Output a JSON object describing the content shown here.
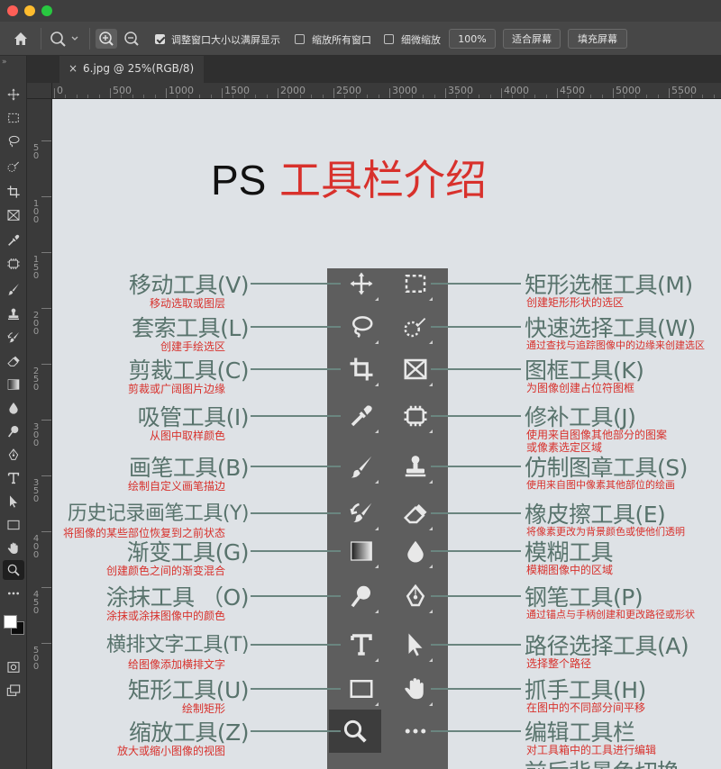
{
  "window": {
    "doc_tab": "6.jpg @ 25%(RGB/8)"
  },
  "options_bar": {
    "resize_windows_label": "调整窗口大小以满屏显示",
    "zoom_all_label": "缩放所有窗口",
    "scrubby_zoom_label": "细微缩放",
    "zoom_value": "100%",
    "fit_screen_label": "适合屏幕",
    "fill_screen_label": "填充屏幕",
    "resize_windows_checked": true,
    "zoom_all_checked": false,
    "scrubby_zoom_checked": false
  },
  "ruler": {
    "h_ticks": [
      "0",
      "500",
      "1000",
      "1500",
      "2000",
      "2500",
      "3000",
      "3500",
      "4000",
      "4500",
      "5000",
      "5500"
    ],
    "v_ticks": [
      "5\n0",
      "1\n0\n0",
      "1\n5\n0",
      "2\n0\n0",
      "2\n5\n0",
      "3\n0\n0",
      "3\n5\n0",
      "4\n0\n0",
      "4\n5\n0",
      "5\n0\n0"
    ]
  },
  "colors": {
    "accent_red": "#d8312c",
    "label_green": "#58736c",
    "canvas_bg": "#dee2e6",
    "panel_bg": "#5e5e5e"
  },
  "infographic": {
    "title_black": "PS",
    "title_red": "工具栏介绍",
    "left": [
      {
        "name": "移动工具(V)",
        "desc": "移动选取或图层"
      },
      {
        "name": "套索工具(L)",
        "desc": "创建手绘选区"
      },
      {
        "name": "剪裁工具(C)",
        "desc": "剪裁或广阔图片边缘"
      },
      {
        "name": "吸管工具(I)",
        "desc": "从图中取样颜色"
      },
      {
        "name": "画笔工具(B)",
        "desc": "绘制自定义画笔描边"
      },
      {
        "name": "历史记录画笔工具(Y)",
        "desc": "将图像的某些部位恢复到之前状态"
      },
      {
        "name": "渐变工具(G)",
        "desc": "创建颜色之间的渐变混合"
      },
      {
        "name": "涂抹工具 （O)",
        "desc": "涂抹或涂抹图像中的颜色"
      },
      {
        "name": "横排文字工具(T)",
        "desc": "给图像添加横排文字"
      },
      {
        "name": "矩形工具(U)",
        "desc": "绘制矩形"
      },
      {
        "name": "缩放工具(Z)",
        "desc": "放大或缩小图像的视图"
      }
    ],
    "right": [
      {
        "name": "矩形选框工具(M)",
        "desc": "创建矩形形状的选区"
      },
      {
        "name": "快速选择工具(W)",
        "desc": "通过查找与追踪图像中的边缘来创建选区"
      },
      {
        "name": "图框工具(K)",
        "desc": "为图像创建占位符图框"
      },
      {
        "name": "修补工具(J)",
        "desc": "使用来自图像其他部分的图案",
        "desc2": "或像素选定区域"
      },
      {
        "name": "仿制图章工具(S)",
        "desc": "使用来自图中像素其他部位的绘画"
      },
      {
        "name": "橡皮擦工具(E)",
        "desc": "将像素更改为背景颜色或使他们透明"
      },
      {
        "name": "模糊工具",
        "desc": "模糊图像中的区域"
      },
      {
        "name": "钢笔工具(P)",
        "desc": "通过锚点与手柄创建和更改路径或形状"
      },
      {
        "name": "路径选择工具(A)",
        "desc": "选择整个路径"
      },
      {
        "name": "抓手工具(H)",
        "desc": "在图中的不同部分间平移"
      },
      {
        "name": "编辑工具栏",
        "desc": "对工具箱中的工具进行编辑"
      }
    ],
    "bottom_partial": "前后背景色切换"
  },
  "icons": {
    "toolstrip": [
      "move-icon",
      "marquee-icon",
      "lasso-icon",
      "quick-select-icon",
      "crop-icon",
      "frame-icon",
      "eyedropper-icon",
      "patch-icon",
      "brush-icon",
      "stamp-icon",
      "history-brush-icon",
      "eraser-icon",
      "gradient-icon",
      "blur-icon",
      "smudge-icon",
      "pen-icon",
      "type-icon",
      "path-select-icon",
      "rectangle-icon",
      "hand-icon",
      "zoom-icon",
      "more-icon"
    ]
  }
}
